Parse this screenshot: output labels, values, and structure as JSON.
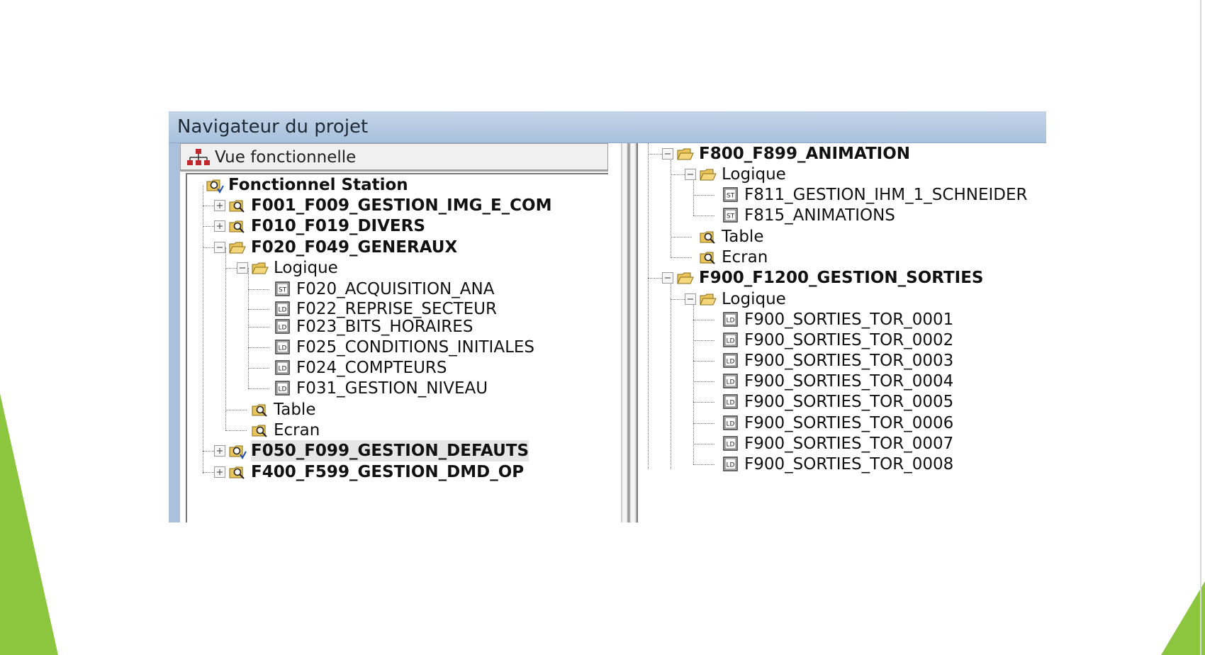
{
  "window": {
    "title": "Navigateur du projet"
  },
  "left_pane": {
    "header": {
      "label": "Vue fonctionnelle",
      "icon": "network-tree-icon"
    },
    "root": {
      "label": "Fonctionnel Station",
      "icon": "folder-open-icon"
    },
    "items": [
      {
        "label": "F001_F009_GESTION_IMG_E_COM",
        "expander": "plus"
      },
      {
        "label": "F010_F019_DIVERS",
        "expander": "plus"
      },
      {
        "label": "F020_F049_GENERAUX",
        "expander": "minus"
      },
      {
        "label": "Logique",
        "expander": "minus"
      },
      {
        "label": "F020_ACQUISITION_ANA",
        "type": "ST"
      },
      {
        "label": "F022_REPRISE_SECTEUR",
        "type": "LD"
      },
      {
        "label": "F023_BITS_HORAIRES",
        "type": "LD"
      },
      {
        "label": "F025_CONDITIONS_INITIALES",
        "type": "LD"
      },
      {
        "label": "F024_COMPTEURS",
        "type": "LD"
      },
      {
        "label": "F031_GESTION_NIVEAU",
        "type": "LD"
      },
      {
        "label": "Table"
      },
      {
        "label": "Ecran"
      },
      {
        "label": "F050_F099_GESTION_DEFAUTS",
        "expander": "plus"
      },
      {
        "label": "F400_F599_GESTION_DMD_OP",
        "expander": "plus"
      }
    ]
  },
  "right_pane": {
    "items": [
      {
        "label": "F800_F899_ANIMATION",
        "expander": "minus"
      },
      {
        "label": "Logique",
        "expander": "minus"
      },
      {
        "label": "F811_GESTION_IHM_1_SCHNEIDER",
        "type": "ST"
      },
      {
        "label": "F815_ANIMATIONS",
        "type": "ST"
      },
      {
        "label": "Table"
      },
      {
        "label": "Ecran"
      },
      {
        "label": "F900_F1200_GESTION_SORTIES",
        "expander": "minus"
      },
      {
        "label": "Logique",
        "expander": "minus"
      },
      {
        "label": "F900_SORTIES_TOR_0001",
        "type": "LD"
      },
      {
        "label": "F900_SORTIES_TOR_0002",
        "type": "LD"
      },
      {
        "label": "F900_SORTIES_TOR_0003",
        "type": "LD"
      },
      {
        "label": "F900_SORTIES_TOR_0004",
        "type": "LD"
      },
      {
        "label": "F900_SORTIES_TOR_0005",
        "type": "LD"
      },
      {
        "label": "F900_SORTIES_TOR_0006",
        "type": "LD"
      },
      {
        "label": "F900_SORTIES_TOR_0007",
        "type": "LD"
      },
      {
        "label": "F900_SORTIES_TOR_0008",
        "type": "LD"
      }
    ]
  },
  "colors": {
    "titlebar": "#b7cbe2",
    "slide_accent": "#8cc63f",
    "folder": "#e8c45a",
    "tree_lines": "#777777"
  }
}
